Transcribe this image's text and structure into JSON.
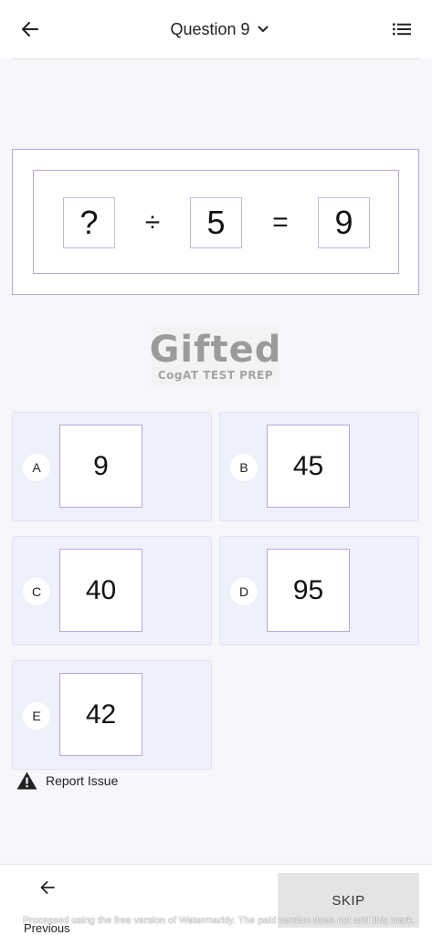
{
  "header": {
    "title": "Question 9"
  },
  "question": {
    "boxes": [
      "?",
      "5",
      "9"
    ],
    "operators": [
      "÷",
      "="
    ]
  },
  "logo": {
    "title": "Gifted",
    "subtitle": "CogAT TEST PREP"
  },
  "options": [
    {
      "letter": "A",
      "value": "9"
    },
    {
      "letter": "B",
      "value": "45"
    },
    {
      "letter": "C",
      "value": "40"
    },
    {
      "letter": "D",
      "value": "95"
    },
    {
      "letter": "E",
      "value": "42"
    }
  ],
  "report": {
    "label": "Report Issue"
  },
  "footer": {
    "previous_label": "Previous",
    "skip_label": "SKIP",
    "watermark": "Processed using the free version of Watermarkly. The paid version does not add this mark."
  },
  "icons": {
    "back": "arrow-left-icon",
    "dropdown": "chevron-down-icon",
    "menu": "list-icon",
    "warning": "warning-triangle-icon",
    "previous": "arrow-left-icon"
  }
}
